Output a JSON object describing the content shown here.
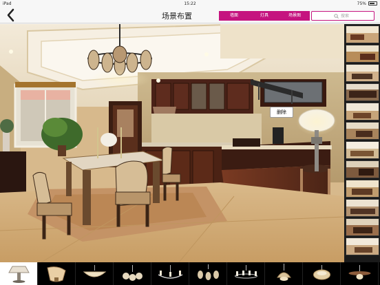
{
  "status": {
    "carrier": "iPad",
    "time": "15:22",
    "battery": "75%"
  },
  "nav": {
    "title": "场景布置"
  },
  "tabs": [
    "墙面",
    "灯具",
    "场景图"
  ],
  "search": {
    "placeholder": "搜索"
  },
  "scene": {
    "delete_label": "删除"
  },
  "thumbnails": [
    {
      "name": "interior-scene-1"
    },
    {
      "name": "interior-scene-2"
    },
    {
      "name": "interior-scene-3"
    },
    {
      "name": "interior-scene-4"
    },
    {
      "name": "interior-scene-5"
    },
    {
      "name": "interior-scene-6"
    },
    {
      "name": "interior-scene-7"
    },
    {
      "name": "interior-scene-8"
    },
    {
      "name": "interior-scene-9"
    },
    {
      "name": "interior-scene-10"
    },
    {
      "name": "interior-scene-11"
    },
    {
      "name": "interior-scene-12"
    }
  ],
  "lamps": [
    {
      "name": "table-lamp"
    },
    {
      "name": "wall-sconce"
    },
    {
      "name": "bowl-ceiling-light"
    },
    {
      "name": "small-chandelier"
    },
    {
      "name": "chandelier-candle"
    },
    {
      "name": "chandelier-pendant"
    },
    {
      "name": "candle-chandelier-2"
    },
    {
      "name": "pendant-lamp"
    },
    {
      "name": "flush-mount-light"
    },
    {
      "name": "ceiling-fan-light"
    }
  ],
  "colors": {
    "accent": "#c5137f",
    "tray_bg": "#000000"
  }
}
